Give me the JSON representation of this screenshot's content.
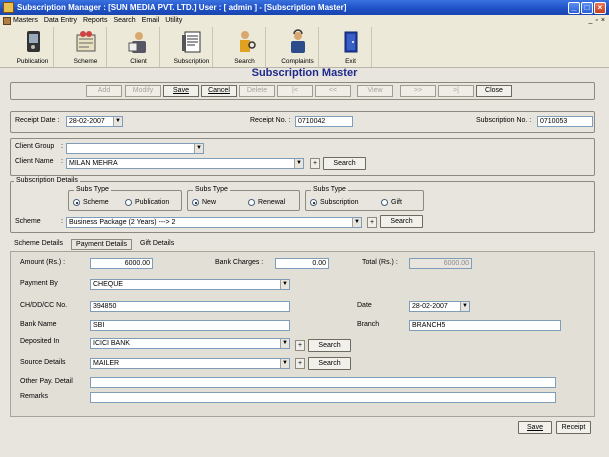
{
  "window": {
    "title": "Subscription Manager : [SUN MEDIA PVT. LTD.] User : [ admin ] - [Subscription Master]"
  },
  "menu": [
    "Masters",
    "Data Entry",
    "Reports",
    "Search",
    "Email",
    "Utility"
  ],
  "toolbar": [
    "Publication",
    "Scheme",
    "Client",
    "Subscription",
    "Search",
    "Complaints",
    "Exit"
  ],
  "form_title": "Subscription Master",
  "nav": {
    "add": "Add",
    "modify": "Modify",
    "save": "Save",
    "cancel": "Cancel",
    "delete": "Delete",
    "first": "|<",
    "prev": "<<",
    "view": "View",
    "next": ">>",
    "last": ">|",
    "close": "Close"
  },
  "receipt": {
    "date_label": "Receipt  Date :",
    "date": "28-02-2007",
    "no_label": "Receipt No. :",
    "no": "0710042",
    "sub_no_label": "Subscription No. :",
    "sub_no": "0710053"
  },
  "client": {
    "group_label": "Client Group",
    "group_value": "",
    "name_label": "Client Name",
    "name_value": "MILAN MEHRA",
    "search": "Search",
    "plus": "+"
  },
  "subscription_details": {
    "title": "Subscription Details",
    "group1": {
      "title": "Subs Type",
      "opt1": "Scheme",
      "opt2": "Publication"
    },
    "group2": {
      "title": "Subs Type",
      "opt1": "New",
      "opt2": "Renewal"
    },
    "group3": {
      "title": "Subs Type",
      "opt1": "Subscription",
      "opt2": "Gift"
    },
    "scheme_label": "Scheme",
    "scheme_value": "Business Package (2 Years) ---> 2",
    "search": "Search",
    "plus": "+"
  },
  "tabs": [
    "Scheme Details",
    "Payment Details",
    "Gift Details"
  ],
  "payment": {
    "amount_label": "Amount (Rs.) :",
    "amount": "6000.00",
    "bank_charges_label": "Bank Charges :",
    "bank_charges": "0.00",
    "total_label": "Total (Rs.) :",
    "total": "6000.00",
    "payment_by_label": "Payment By",
    "payment_by": "CHEQUE",
    "chq_label": "CH/DD/CC No.",
    "chq_no": "394850",
    "date_label": "Date",
    "date": "28-02-2007",
    "bank_label": "Bank Name",
    "bank": "SBI",
    "branch_label": "Branch",
    "branch": "BRANCH5",
    "deposited_label": "Deposited In",
    "deposited": "ICICI BANK",
    "source_label": "Source Details",
    "source": "MAILER",
    "other_label": "Other Pay. Detail",
    "other": "",
    "remarks_label": "Remarks",
    "remarks": "",
    "search": "Search",
    "plus": "+"
  },
  "bottom": {
    "save": "Save",
    "receipt": "Receipt"
  }
}
